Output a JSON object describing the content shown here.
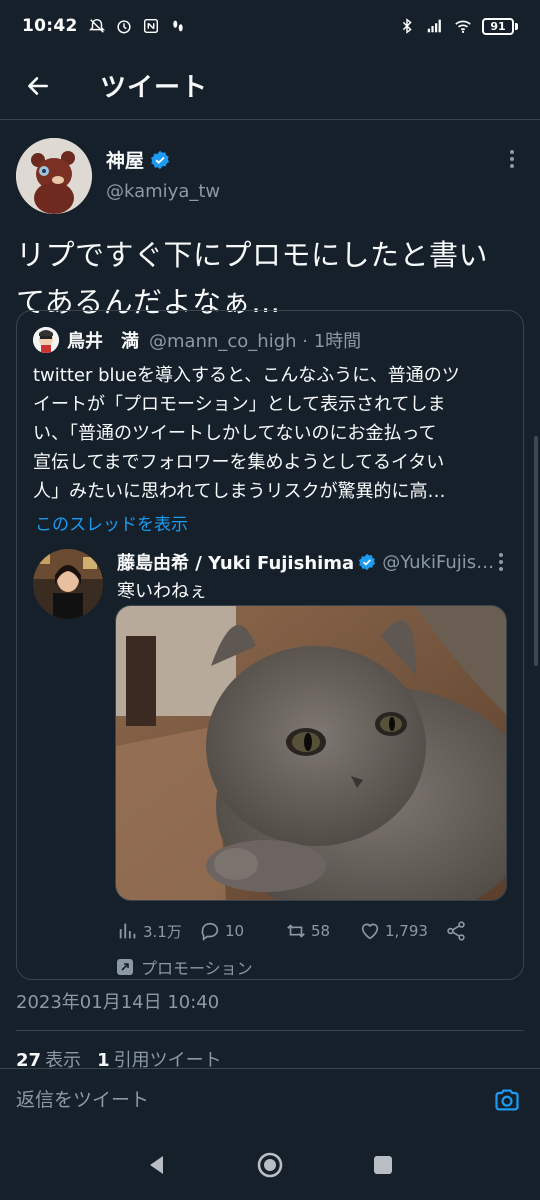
{
  "status_bar": {
    "time": "10:42",
    "battery": "91",
    "icons_left": [
      "mute-icon",
      "alarm-icon",
      "nfc-icon",
      "steps-icon"
    ],
    "icons_right": [
      "bluetooth-icon",
      "signal-icon",
      "wifi-icon",
      "battery-icon"
    ]
  },
  "header": {
    "title": "ツイート"
  },
  "tweet": {
    "display_name": "神屋",
    "handle": "@kamiya_tw",
    "text": "リプですぐ下にプロモにしたと書い\nてあるんだよなぁ…",
    "timestamp": "2023年01月14日 10:40",
    "stats": {
      "views_count": "27",
      "views_label": "表示",
      "quotes_count": "1",
      "quotes_label": "引用ツイート"
    }
  },
  "quote": {
    "display_name": "鳥井　満",
    "handle_time": "@mann_co_high · 1時間",
    "text": "twitter blueを導入すると、こんなふうに、普通のツ\nイートが「プロモーション」として表示されてしま\nい、「普通のツイートしかしてないのにお金払って\n宣伝してまでフォロワーを集めようとしてるイタい\n人」みたいに思われてしまうリスクが驚異的に高…",
    "thread_link": "このスレッドを表示",
    "nested": {
      "display_name": "藤島由希 / Yuki Fujishima",
      "handle": "@YukiFujishima",
      "text": "寒いわねぇ",
      "actions": {
        "views": "3.1万",
        "replies": "10",
        "retweets": "58",
        "likes": "1,793"
      },
      "promo_label": "プロモーション"
    }
  },
  "reply_bar": {
    "placeholder": "返信をツイート"
  },
  "colors": {
    "background": "#15202b",
    "accent": "#1d9bf0",
    "secondary_text": "#8b98a5",
    "border": "#38444d"
  }
}
